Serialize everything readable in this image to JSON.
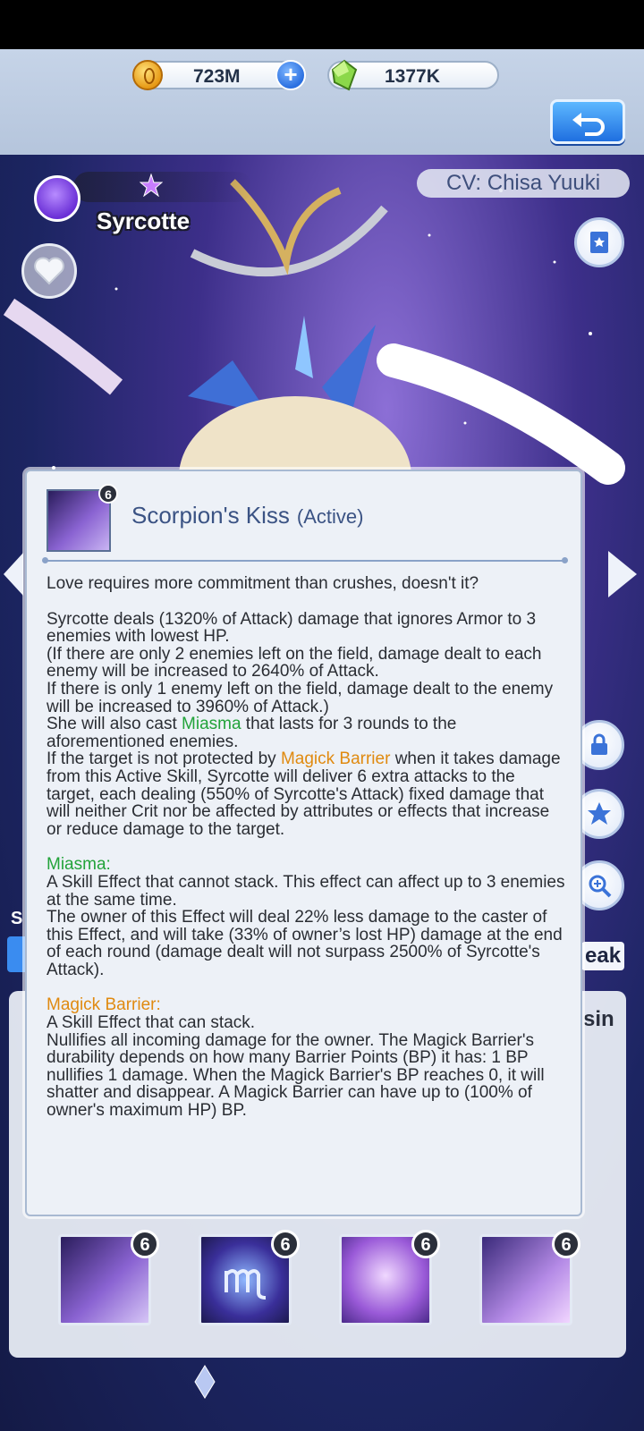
{
  "currency": {
    "gold": "723M",
    "gems": "1377K"
  },
  "character": {
    "name": "Syrcotte",
    "cv": "CV: Chisa Yuuki"
  },
  "skill": {
    "name": "Scorpion's Kiss",
    "type": "(Active)",
    "level": "6",
    "flavor": "Love requires more commitment than crushes, doesn't it?",
    "p1": "Syrcotte deals (1320% of Attack) damage that ignores Armor to 3 enemies with lowest HP.",
    "p2": "(If there are only 2 enemies left on the field, damage dealt to each enemy will be increased to 2640% of Attack.",
    "p3": "If there is only 1 enemy left on the field, damage dealt to the enemy will be increased to 3960% of Attack.)",
    "p4a": "She will also cast ",
    "p4b": "Miasma",
    "p4c": " that lasts for 3 rounds to the aforementioned enemies.",
    "p5a": "If the target is not protected by ",
    "p5b": "Magick Barrier",
    "p5c": " when it takes damage from this Active Skill, Syrcotte will deliver 6 extra attacks to the target, each dealing (550% of Syrcotte's Attack) fixed damage that will neither Crit nor be affected by attributes or effects that increase or reduce damage to the target.",
    "miasma_title": "Miasma:",
    "miasma_1": "A Skill Effect that cannot stack. This effect can affect up to 3 enemies at the same time.",
    "miasma_2": "The owner of this Effect will deal 22% less damage to the caster of this Effect, and will take (33% of owner’s lost HP) damage at the end of each round (damage dealt will not surpass 2500% of Syrcotte's Attack).",
    "barrier_title": "Magick Barrier:",
    "barrier_1": "A Skill Effect that can stack.",
    "barrier_2": "Nullifies all incoming damage for the owner. The Magick Barrier's durability depends on how many Barrier Points (BP) it has: 1 BP nullifies 1 damage. When the Magick Barrier's BP reaches 0, it will shatter and disappear. A Magick Barrier can have up to (100% of owner's maximum HP) BP."
  },
  "skill_slots": [
    {
      "level": "6",
      "icon": "scorpion-kiss-icon"
    },
    {
      "level": "6",
      "icon": "scorpio-sign-icon"
    },
    {
      "level": "6",
      "icon": "embrace-icon"
    },
    {
      "level": "6",
      "icon": "dance-icon"
    }
  ],
  "edge": {
    "left_letter": "S",
    "right_top": "eak",
    "right_bottom": "sin"
  }
}
